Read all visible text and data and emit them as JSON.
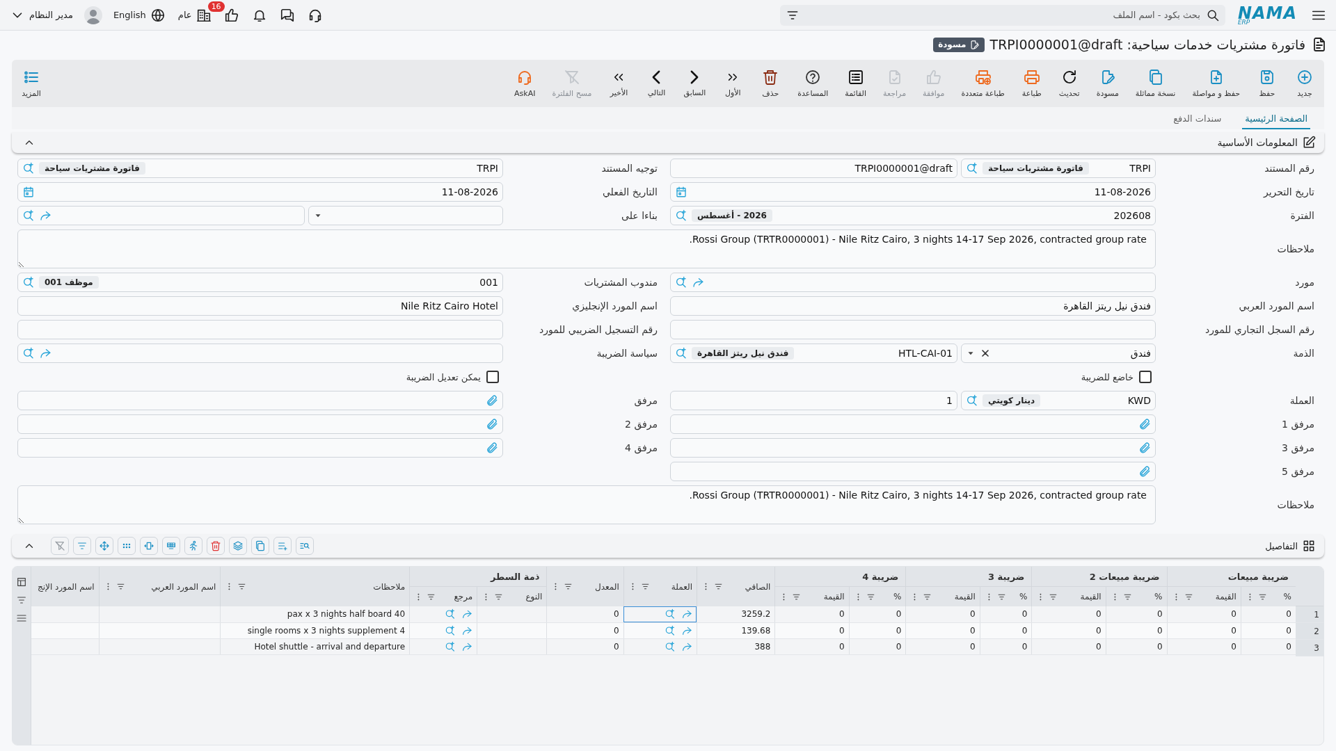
{
  "logo": {
    "text": "NAMA",
    "sub": "ERP"
  },
  "search": {
    "placeholder": "بحث بكود - اسم الملف"
  },
  "topbar": {
    "badge": "16",
    "branch": "عام",
    "language": "English",
    "user": "مدير النظام"
  },
  "title": {
    "text": "فاتورة مشتريات خدمات سياحية: TRPI0000001@draft",
    "status": "مسودة"
  },
  "toolbar": [
    {
      "label": "جديد",
      "disabled": false
    },
    {
      "label": "حفظ",
      "disabled": false
    },
    {
      "label": "حفظ و مواصلة",
      "disabled": false
    },
    {
      "label": "نسخة مماثلة",
      "disabled": false
    },
    {
      "label": "مسودة",
      "disabled": false
    },
    {
      "label": "تحديث",
      "disabled": false
    },
    {
      "label": "طباعة",
      "disabled": false
    },
    {
      "label": "طباعة متعددة",
      "disabled": false
    },
    {
      "label": "موافقة",
      "disabled": true
    },
    {
      "label": "مراجعة",
      "disabled": true
    },
    {
      "label": "القائمة",
      "disabled": false
    },
    {
      "label": "المساعدة",
      "disabled": false
    },
    {
      "label": "حذف",
      "disabled": false
    },
    {
      "label": "الأول",
      "disabled": false
    },
    {
      "label": "السابق",
      "disabled": false
    },
    {
      "label": "التالي",
      "disabled": false
    },
    {
      "label": "الأخير",
      "disabled": false
    },
    {
      "label": "مسح الفلترة",
      "disabled": true
    },
    {
      "label": "AskAI",
      "disabled": false
    }
  ],
  "more": "المزيد",
  "tabs": [
    {
      "label": "الصفحة الرئيسية",
      "selected": true
    },
    {
      "label": "سندات الدفع",
      "selected": false
    }
  ],
  "section": {
    "title": "المعلومات الأساسية"
  },
  "form": [
    {
      "right": {
        "label": "رقم المستند",
        "boxes": [
          {
            "kind": "lookup",
            "value": "TRPI",
            "chip": "فاتورة مشتريات سياحة",
            "share": false
          },
          {
            "kind": "text",
            "value": "TRPI0000001@draft"
          }
        ]
      },
      "left": {
        "label": "توجيه المستند",
        "boxes": [
          {
            "kind": "lookup",
            "value": "TRPI",
            "chip": "فاتورة مشتريات سياحة",
            "share": false
          }
        ]
      }
    },
    {
      "right": {
        "label": "تاريخ التحرير",
        "boxes": [
          {
            "kind": "date",
            "value": "11-08-2026"
          }
        ]
      },
      "left": {
        "label": "التاريخ الفعلي",
        "boxes": [
          {
            "kind": "date",
            "value": "11-08-2026"
          }
        ]
      }
    },
    {
      "right": {
        "label": "الفترة",
        "boxes": [
          {
            "kind": "lookup",
            "value": "202608",
            "chip": "2026 - أغسطس",
            "share": false
          }
        ]
      },
      "left": {
        "label": "بناءا على",
        "boxes": [
          {
            "kind": "select",
            "clearable": false
          },
          {
            "kind": "lookup",
            "share": true
          }
        ]
      }
    },
    {
      "full": {
        "label": "ملاحظات",
        "boxes": [
          {
            "kind": "notes",
            "value": "Rossi Group (TRTR0000001) - Nile Ritz Cairo, 3 nights 14-17 Sep 2026, contracted group rate."
          }
        ]
      }
    },
    {
      "right": {
        "label": "مورد",
        "boxes": [
          {
            "kind": "lookup",
            "share": true
          }
        ]
      },
      "left": {
        "label": "مندوب المشتريات",
        "boxes": [
          {
            "kind": "lookup",
            "value": "001",
            "chip": "موظف 001",
            "share": false
          }
        ]
      }
    },
    {
      "right": {
        "label": "اسم المورد العربي",
        "boxes": [
          {
            "kind": "text",
            "value": "فندق نيل ريتز القاهرة"
          }
        ]
      },
      "left": {
        "label": "اسم المورد الإنجليزي",
        "boxes": [
          {
            "kind": "text",
            "value": "Nile Ritz Cairo Hotel"
          }
        ]
      }
    },
    {
      "right": {
        "label": "رقم السجل التجاري للمورد",
        "boxes": [
          {
            "kind": "text"
          }
        ]
      },
      "left": {
        "label": "رقم التسجيل الضريبي للمورد",
        "boxes": [
          {
            "kind": "text"
          }
        ]
      }
    },
    {
      "right": {
        "label": "الذمة",
        "boxes": [
          {
            "kind": "select",
            "value": "فندق",
            "clearable": true
          },
          {
            "kind": "lookup",
            "value": "HTL-CAI-01",
            "chip": "فندق نيل ريتز القاهرة",
            "share": false
          }
        ]
      },
      "left": {
        "label": "سياسة الضريبة",
        "boxes": [
          {
            "kind": "lookup",
            "share": true
          }
        ]
      }
    },
    {
      "right": {
        "kind": "checkbox",
        "label": "خاضع للضريبة",
        "checked": false
      },
      "left": {
        "kind": "checkbox",
        "label": "يمكن تعديل الضريبة",
        "checked": false
      }
    },
    {
      "right": {
        "label": "العملة",
        "boxes": [
          {
            "kind": "lookup",
            "value": "KWD",
            "chip": "دينار كويتي",
            "share": false
          },
          {
            "kind": "text",
            "value": "1"
          }
        ]
      },
      "left": {
        "label": "مرفق",
        "boxes": [
          {
            "kind": "attachment"
          }
        ]
      }
    },
    {
      "right": {
        "label": "مرفق 1",
        "boxes": [
          {
            "kind": "attachment"
          }
        ]
      },
      "left": {
        "label": "مرفق 2",
        "boxes": [
          {
            "kind": "attachment"
          }
        ]
      }
    },
    {
      "right": {
        "label": "مرفق 3",
        "boxes": [
          {
            "kind": "attachment"
          }
        ]
      },
      "left": {
        "label": "مرفق 4",
        "boxes": [
          {
            "kind": "attachment"
          }
        ]
      }
    },
    {
      "right": {
        "label": "مرفق 5",
        "boxes": [
          {
            "kind": "attachment"
          }
        ]
      }
    },
    {
      "full": {
        "label": "ملاحظات",
        "boxes": [
          {
            "kind": "notes",
            "value": "Rossi Group (TRTR0000001) - Nile Ritz Cairo, 3 nights 14-17 Sep 2026, contracted group rate."
          }
        ]
      }
    }
  ],
  "details": {
    "title": "التفاصيل",
    "tools": [
      {
        "disabled": false
      },
      {
        "disabled": false
      },
      {
        "disabled": false
      },
      {
        "disabled": false
      },
      {
        "disabled": false
      },
      {
        "disabled": false
      },
      {
        "disabled": false
      },
      {
        "disabled": false
      },
      {
        "disabled": false
      },
      {
        "disabled": false
      },
      {
        "disabled": false
      },
      {
        "disabled": true
      }
    ],
    "column_groups": [
      {
        "label": "ضريبة مبيعات"
      },
      {
        "label": "ضريبة مبيعات 2"
      },
      {
        "label": "ضريبة 3"
      },
      {
        "label": "ضريبة 4"
      },
      {
        "label": "ذمة السطر"
      }
    ],
    "columns": [
      {
        "label": "%",
        "grouped": true,
        "group_start": true,
        "cut": false
      },
      {
        "label": "القيمة",
        "grouped": true,
        "group_start": false,
        "cut": false
      },
      {
        "label": "%",
        "grouped": true,
        "group_start": true,
        "cut": false
      },
      {
        "label": "القيمة",
        "grouped": true,
        "group_start": false,
        "cut": false
      },
      {
        "label": "%",
        "grouped": true,
        "group_start": true,
        "cut": false
      },
      {
        "label": "القيمة",
        "grouped": true,
        "group_start": false,
        "cut": false
      },
      {
        "label": "%",
        "grouped": true,
        "group_start": true,
        "cut": false
      },
      {
        "label": "القيمة",
        "grouped": true,
        "group_start": false,
        "cut": false
      },
      {
        "label": "الصافي",
        "grouped": false,
        "cut": false
      },
      {
        "label": "العملة",
        "grouped": false,
        "cut": false
      },
      {
        "label": "المعدل",
        "grouped": false,
        "cut": false
      },
      {
        "label": "النوع",
        "grouped": true,
        "group_start": true,
        "cut": false
      },
      {
        "label": "مرجع",
        "grouped": true,
        "group_start": false,
        "cut": false
      },
      {
        "label": "ملاحظات",
        "grouped": false,
        "cut": false
      },
      {
        "label": "اسم المورد العربي",
        "grouped": false,
        "cut": false
      },
      {
        "label": "اسم المورد الإنج",
        "grouped": false,
        "cut": true
      }
    ],
    "rows": [
      {
        "number": "1",
        "cells": [
          {
            "kind": "text",
            "value": "0",
            "focused": false
          },
          {
            "kind": "text",
            "value": "0",
            "focused": false
          },
          {
            "kind": "text",
            "value": "0",
            "focused": false
          },
          {
            "kind": "text",
            "value": "0",
            "focused": false
          },
          {
            "kind": "text",
            "value": "0",
            "focused": false
          },
          {
            "kind": "text",
            "value": "0",
            "focused": false
          },
          {
            "kind": "text",
            "value": "0",
            "focused": false
          },
          {
            "kind": "text",
            "value": "0",
            "focused": false
          },
          {
            "kind": "text",
            "value": "3259.2",
            "focused": false
          },
          {
            "kind": "lookup",
            "share": true,
            "focused": true
          },
          {
            "kind": "text",
            "value": "0",
            "focused": false
          },
          {
            "kind": "text",
            "focused": false
          },
          {
            "kind": "lookup",
            "share": true,
            "focused": false
          },
          {
            "kind": "text",
            "value": "40 pax x 3 nights half board",
            "focused": false
          },
          {
            "kind": "text",
            "focused": false
          },
          {
            "kind": "text",
            "focused": false
          }
        ]
      },
      {
        "number": "2",
        "cells": [
          {
            "kind": "text",
            "value": "0",
            "focused": false
          },
          {
            "kind": "text",
            "value": "0",
            "focused": false
          },
          {
            "kind": "text",
            "value": "0",
            "focused": false
          },
          {
            "kind": "text",
            "value": "0",
            "focused": false
          },
          {
            "kind": "text",
            "value": "0",
            "focused": false
          },
          {
            "kind": "text",
            "value": "0",
            "focused": false
          },
          {
            "kind": "text",
            "value": "0",
            "focused": false
          },
          {
            "kind": "text",
            "value": "0",
            "focused": false
          },
          {
            "kind": "text",
            "value": "139.68",
            "focused": false
          },
          {
            "kind": "lookup",
            "share": true,
            "focused": false
          },
          {
            "kind": "text",
            "value": "0",
            "focused": false
          },
          {
            "kind": "text",
            "focused": false
          },
          {
            "kind": "lookup",
            "share": true,
            "focused": false
          },
          {
            "kind": "text",
            "value": "4 single rooms x 3 nights supplement",
            "focused": false
          },
          {
            "kind": "text",
            "focused": false
          },
          {
            "kind": "text",
            "focused": false
          }
        ]
      },
      {
        "number": "3",
        "cells": [
          {
            "kind": "text",
            "value": "0",
            "focused": false
          },
          {
            "kind": "text",
            "value": "0",
            "focused": false
          },
          {
            "kind": "text",
            "value": "0",
            "focused": false
          },
          {
            "kind": "text",
            "value": "0",
            "focused": false
          },
          {
            "kind": "text",
            "value": "0",
            "focused": false
          },
          {
            "kind": "text",
            "value": "0",
            "focused": false
          },
          {
            "kind": "text",
            "value": "0",
            "focused": false
          },
          {
            "kind": "text",
            "value": "0",
            "focused": false
          },
          {
            "kind": "text",
            "value": "388",
            "focused": false
          },
          {
            "kind": "lookup",
            "share": true,
            "focused": false
          },
          {
            "kind": "text",
            "value": "0",
            "focused": false
          },
          {
            "kind": "text",
            "focused": false
          },
          {
            "kind": "lookup",
            "share": true,
            "focused": false
          },
          {
            "kind": "text",
            "value": "Hotel shuttle - arrival and departure",
            "focused": false
          },
          {
            "kind": "text",
            "focused": false
          },
          {
            "kind": "text",
            "focused": false
          }
        ]
      }
    ]
  }
}
